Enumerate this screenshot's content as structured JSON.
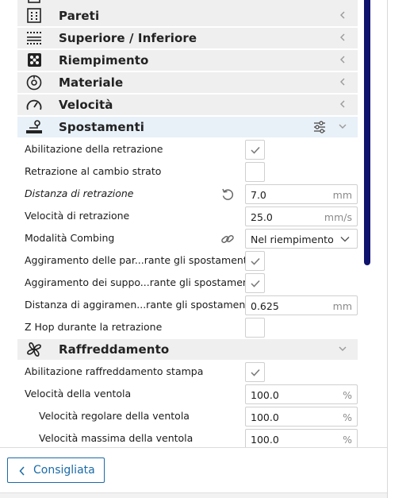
{
  "categories": [
    {
      "label": "Pareti",
      "icon": "walls-icon"
    },
    {
      "label": "Superiore / Inferiore",
      "icon": "top-bottom-icon"
    },
    {
      "label": "Riempimento",
      "icon": "infill-icon"
    },
    {
      "label": "Materiale",
      "icon": "material-icon"
    },
    {
      "label": "Velocità",
      "icon": "speed-icon"
    },
    {
      "label": "Spostamenti",
      "icon": "travel-icon"
    },
    {
      "label": "Raffreddamento",
      "icon": "cooling-fan-icon"
    }
  ],
  "travel_settings": [
    {
      "label": "Abilitazione della retrazione",
      "checked": true
    },
    {
      "label": "Retrazione al cambio strato",
      "checked": false
    },
    {
      "label": "Distanza di retrazione",
      "value": "7.0",
      "unit": "mm"
    },
    {
      "label": "Velocità di retrazione",
      "value": "25.0",
      "unit": "mm/s"
    },
    {
      "label": "Modalità Combing",
      "value": "Nel riempimento"
    },
    {
      "label": "Aggiramento delle par...rante gli spostamenti",
      "checked": true
    },
    {
      "label": "Aggiramento dei suppo...rante gli spostamenti",
      "checked": true
    },
    {
      "label": "Distanza di aggiramen...rante gli spostamenti",
      "value": "0.625",
      "unit": "mm"
    },
    {
      "label": "Z Hop durante la retrazione",
      "checked": false
    }
  ],
  "cooling_settings": [
    {
      "label": "Abilitazione raffreddamento stampa",
      "checked": true
    },
    {
      "label": "Velocità della ventola",
      "value": "100.0",
      "unit": "%"
    },
    {
      "label": "Velocità regolare della ventola",
      "value": "100.0",
      "unit": "%"
    },
    {
      "label": "Velocità massima della ventola",
      "value": "100.0",
      "unit": "%"
    }
  ],
  "footer": {
    "recommended_button": "Consigliata"
  },
  "colors": {
    "accent": "#1a6ba8",
    "scrollbar": "#10136e",
    "active_category": "#e8f0f8",
    "category_bg": "#efefef"
  }
}
